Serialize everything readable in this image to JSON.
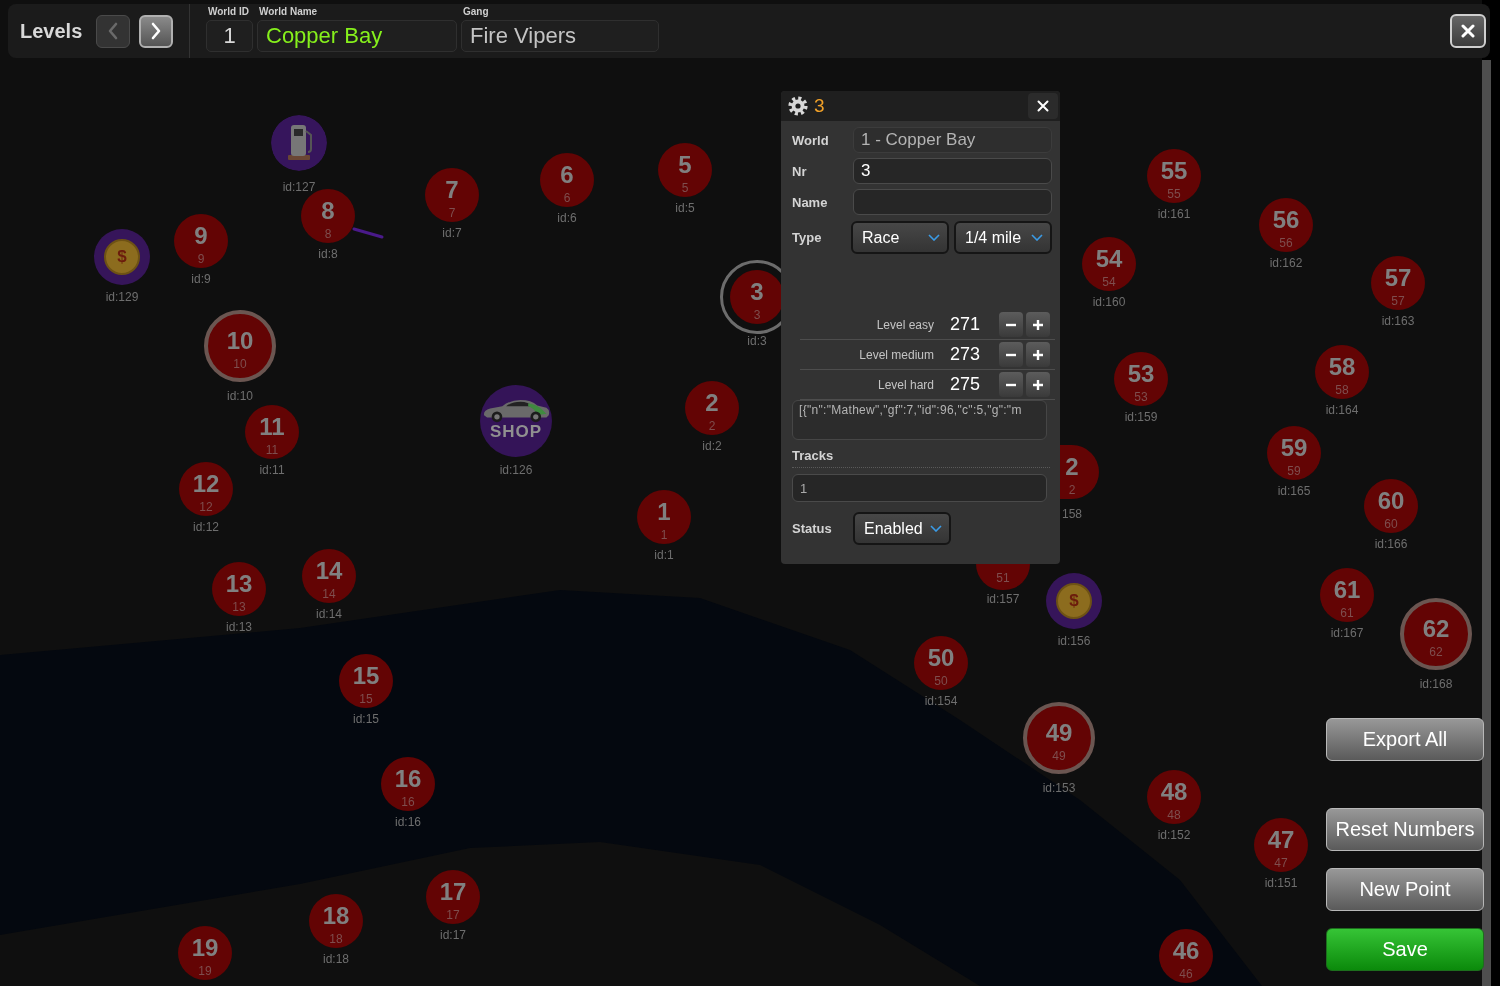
{
  "top_bar": {
    "title": "Levels",
    "nav_buttons": [
      {
        "kind": "prev",
        "disabled": true
      },
      {
        "kind": "next",
        "disabled": false
      }
    ],
    "fields": [
      {
        "label": "World ID",
        "value": "1",
        "color": "#d8d8d8"
      },
      {
        "label": "World Name",
        "value": "Copper Bay",
        "color": "#86f01c"
      },
      {
        "label": "Gang",
        "value": "Fire Vipers",
        "color": "#c4c4c4"
      }
    ]
  },
  "map": {
    "markers": [
      {
        "kind": "fuel",
        "id_label": "id:127",
        "selected": false,
        "highlighted": false
      },
      {
        "kind": "level",
        "number": "6",
        "sub": "6",
        "id_label": "id:6",
        "selected": false,
        "highlighted": false
      },
      {
        "kind": "level",
        "number": "5",
        "sub": "5",
        "id_label": "id:5",
        "selected": false,
        "highlighted": false
      },
      {
        "kind": "level",
        "number": "55",
        "sub": "55",
        "id_label": "id:161",
        "selected": false,
        "highlighted": false
      },
      {
        "kind": "level",
        "number": "8",
        "sub": "8",
        "id_label": "id:8",
        "selected": false,
        "highlighted": false
      },
      {
        "kind": "level",
        "number": "7",
        "sub": "7",
        "id_label": "id:7",
        "selected": false,
        "highlighted": false
      },
      {
        "kind": "level",
        "number": "56",
        "sub": "56",
        "id_label": "id:162",
        "selected": false,
        "highlighted": false
      },
      {
        "kind": "coin",
        "symbol": "$",
        "id_label": "id:129",
        "selected": false,
        "highlighted": false
      },
      {
        "kind": "level",
        "number": "9",
        "sub": "9",
        "id_label": "id:9",
        "selected": false,
        "highlighted": false
      },
      {
        "kind": "level",
        "number": "54",
        "sub": "54",
        "id_label": "id:160",
        "selected": false,
        "highlighted": false
      },
      {
        "kind": "level",
        "number": "3",
        "sub": "3",
        "id_label": "id:3",
        "selected": true,
        "highlighted": false
      },
      {
        "kind": "level",
        "number": "57",
        "sub": "57",
        "id_label": "id:163",
        "selected": false,
        "highlighted": false
      },
      {
        "kind": "level",
        "number": "10",
        "sub": "10",
        "id_label": "id:10",
        "selected": false,
        "highlighted": true
      },
      {
        "kind": "level",
        "number": "53",
        "sub": "53",
        "id_label": "id:159",
        "selected": false,
        "highlighted": false
      },
      {
        "kind": "level",
        "number": "58",
        "sub": "58",
        "id_label": "id:164",
        "selected": false,
        "highlighted": false
      },
      {
        "kind": "level",
        "number": "11",
        "sub": "11",
        "id_label": "id:11",
        "selected": false,
        "highlighted": false
      },
      {
        "kind": "shop",
        "label": "SHOP",
        "id_label": "id:126",
        "selected": false,
        "highlighted": false
      },
      {
        "kind": "level",
        "number": "2",
        "sub": "2",
        "id_label": "id:2",
        "selected": false,
        "highlighted": false
      },
      {
        "kind": "level",
        "number": "12",
        "sub": "12",
        "id_label": "id:12",
        "selected": false,
        "highlighted": false
      },
      {
        "kind": "level",
        "number": "2",
        "sub": "2",
        "id_label": "158",
        "selected": false,
        "highlighted": false
      },
      {
        "kind": "level",
        "number": "59",
        "sub": "59",
        "id_label": "id:165",
        "selected": false,
        "highlighted": false
      },
      {
        "kind": "level",
        "number": "1",
        "sub": "1",
        "id_label": "id:1",
        "selected": false,
        "highlighted": false
      },
      {
        "kind": "level",
        "number": "60",
        "sub": "60",
        "id_label": "id:166",
        "selected": false,
        "highlighted": false
      },
      {
        "kind": "level",
        "number": "13",
        "sub": "13",
        "id_label": "id:13",
        "selected": false,
        "highlighted": false
      },
      {
        "kind": "level",
        "number": "14",
        "sub": "14",
        "id_label": "id:14",
        "selected": false,
        "highlighted": false
      },
      {
        "kind": "level",
        "sub": "51",
        "id_label": "id:157",
        "selected": false,
        "highlighted": false
      },
      {
        "kind": "coin",
        "symbol": "$",
        "id_label": "id:156",
        "selected": false,
        "highlighted": false
      },
      {
        "kind": "level",
        "number": "61",
        "sub": "61",
        "id_label": "id:167",
        "selected": false,
        "highlighted": false
      },
      {
        "kind": "level",
        "number": "50",
        "sub": "50",
        "id_label": "id:154",
        "selected": false,
        "highlighted": false
      },
      {
        "kind": "level",
        "number": "62",
        "sub": "62",
        "id_label": "id:168",
        "selected": false,
        "highlighted": true
      },
      {
        "kind": "level",
        "number": "15",
        "sub": "15",
        "id_label": "id:15",
        "selected": false,
        "highlighted": false
      },
      {
        "kind": "level",
        "number": "49",
        "sub": "49",
        "id_label": "id:153",
        "selected": false,
        "highlighted": true
      },
      {
        "kind": "level",
        "number": "16",
        "sub": "16",
        "id_label": "id:16",
        "selected": false,
        "highlighted": false
      },
      {
        "kind": "level",
        "number": "48",
        "sub": "48",
        "id_label": "id:152",
        "selected": false,
        "highlighted": false
      },
      {
        "kind": "level",
        "number": "47",
        "sub": "47",
        "id_label": "id:151",
        "selected": false,
        "highlighted": false
      },
      {
        "kind": "level",
        "number": "18",
        "sub": "18",
        "id_label": "id:18",
        "selected": false,
        "highlighted": false
      },
      {
        "kind": "level",
        "number": "17",
        "sub": "17",
        "id_label": "id:17",
        "selected": false,
        "highlighted": false
      },
      {
        "kind": "level",
        "number": "19",
        "sub": "19",
        "selected": false,
        "highlighted": false
      },
      {
        "kind": "level",
        "number": "46",
        "sub": "46",
        "selected": false,
        "highlighted": false
      }
    ]
  },
  "dialog": {
    "title": "3",
    "fields": [
      {
        "kind": "readonly",
        "label": "World",
        "value": "1 - Copper Bay"
      },
      {
        "kind": "input",
        "label": "Nr",
        "value": "3"
      },
      {
        "kind": "input",
        "label": "Name"
      },
      {
        "kind": "select",
        "label": "Type",
        "values": [
          "Race",
          "1/4 mile"
        ]
      }
    ],
    "levels": [
      {
        "label": "Level easy",
        "value": "271"
      },
      {
        "label": "Level medium",
        "value": "273"
      },
      {
        "label": "Level hard",
        "value": "275"
      }
    ],
    "data_text": "[{\"n\":\"Mathew\",\"gf\":7,\"id\":96,\"c\":5,\"g\":\"m",
    "tracks": {
      "label": "Tracks",
      "value": "1"
    },
    "status": {
      "label": "Status",
      "value": "Enabled"
    }
  },
  "actions": [
    {
      "label": "Export All",
      "kind": "default"
    },
    {
      "label": "Reset Numbers",
      "kind": "default"
    },
    {
      "label": "New Point",
      "kind": "default"
    },
    {
      "label": "Save",
      "kind": "primary"
    }
  ]
}
